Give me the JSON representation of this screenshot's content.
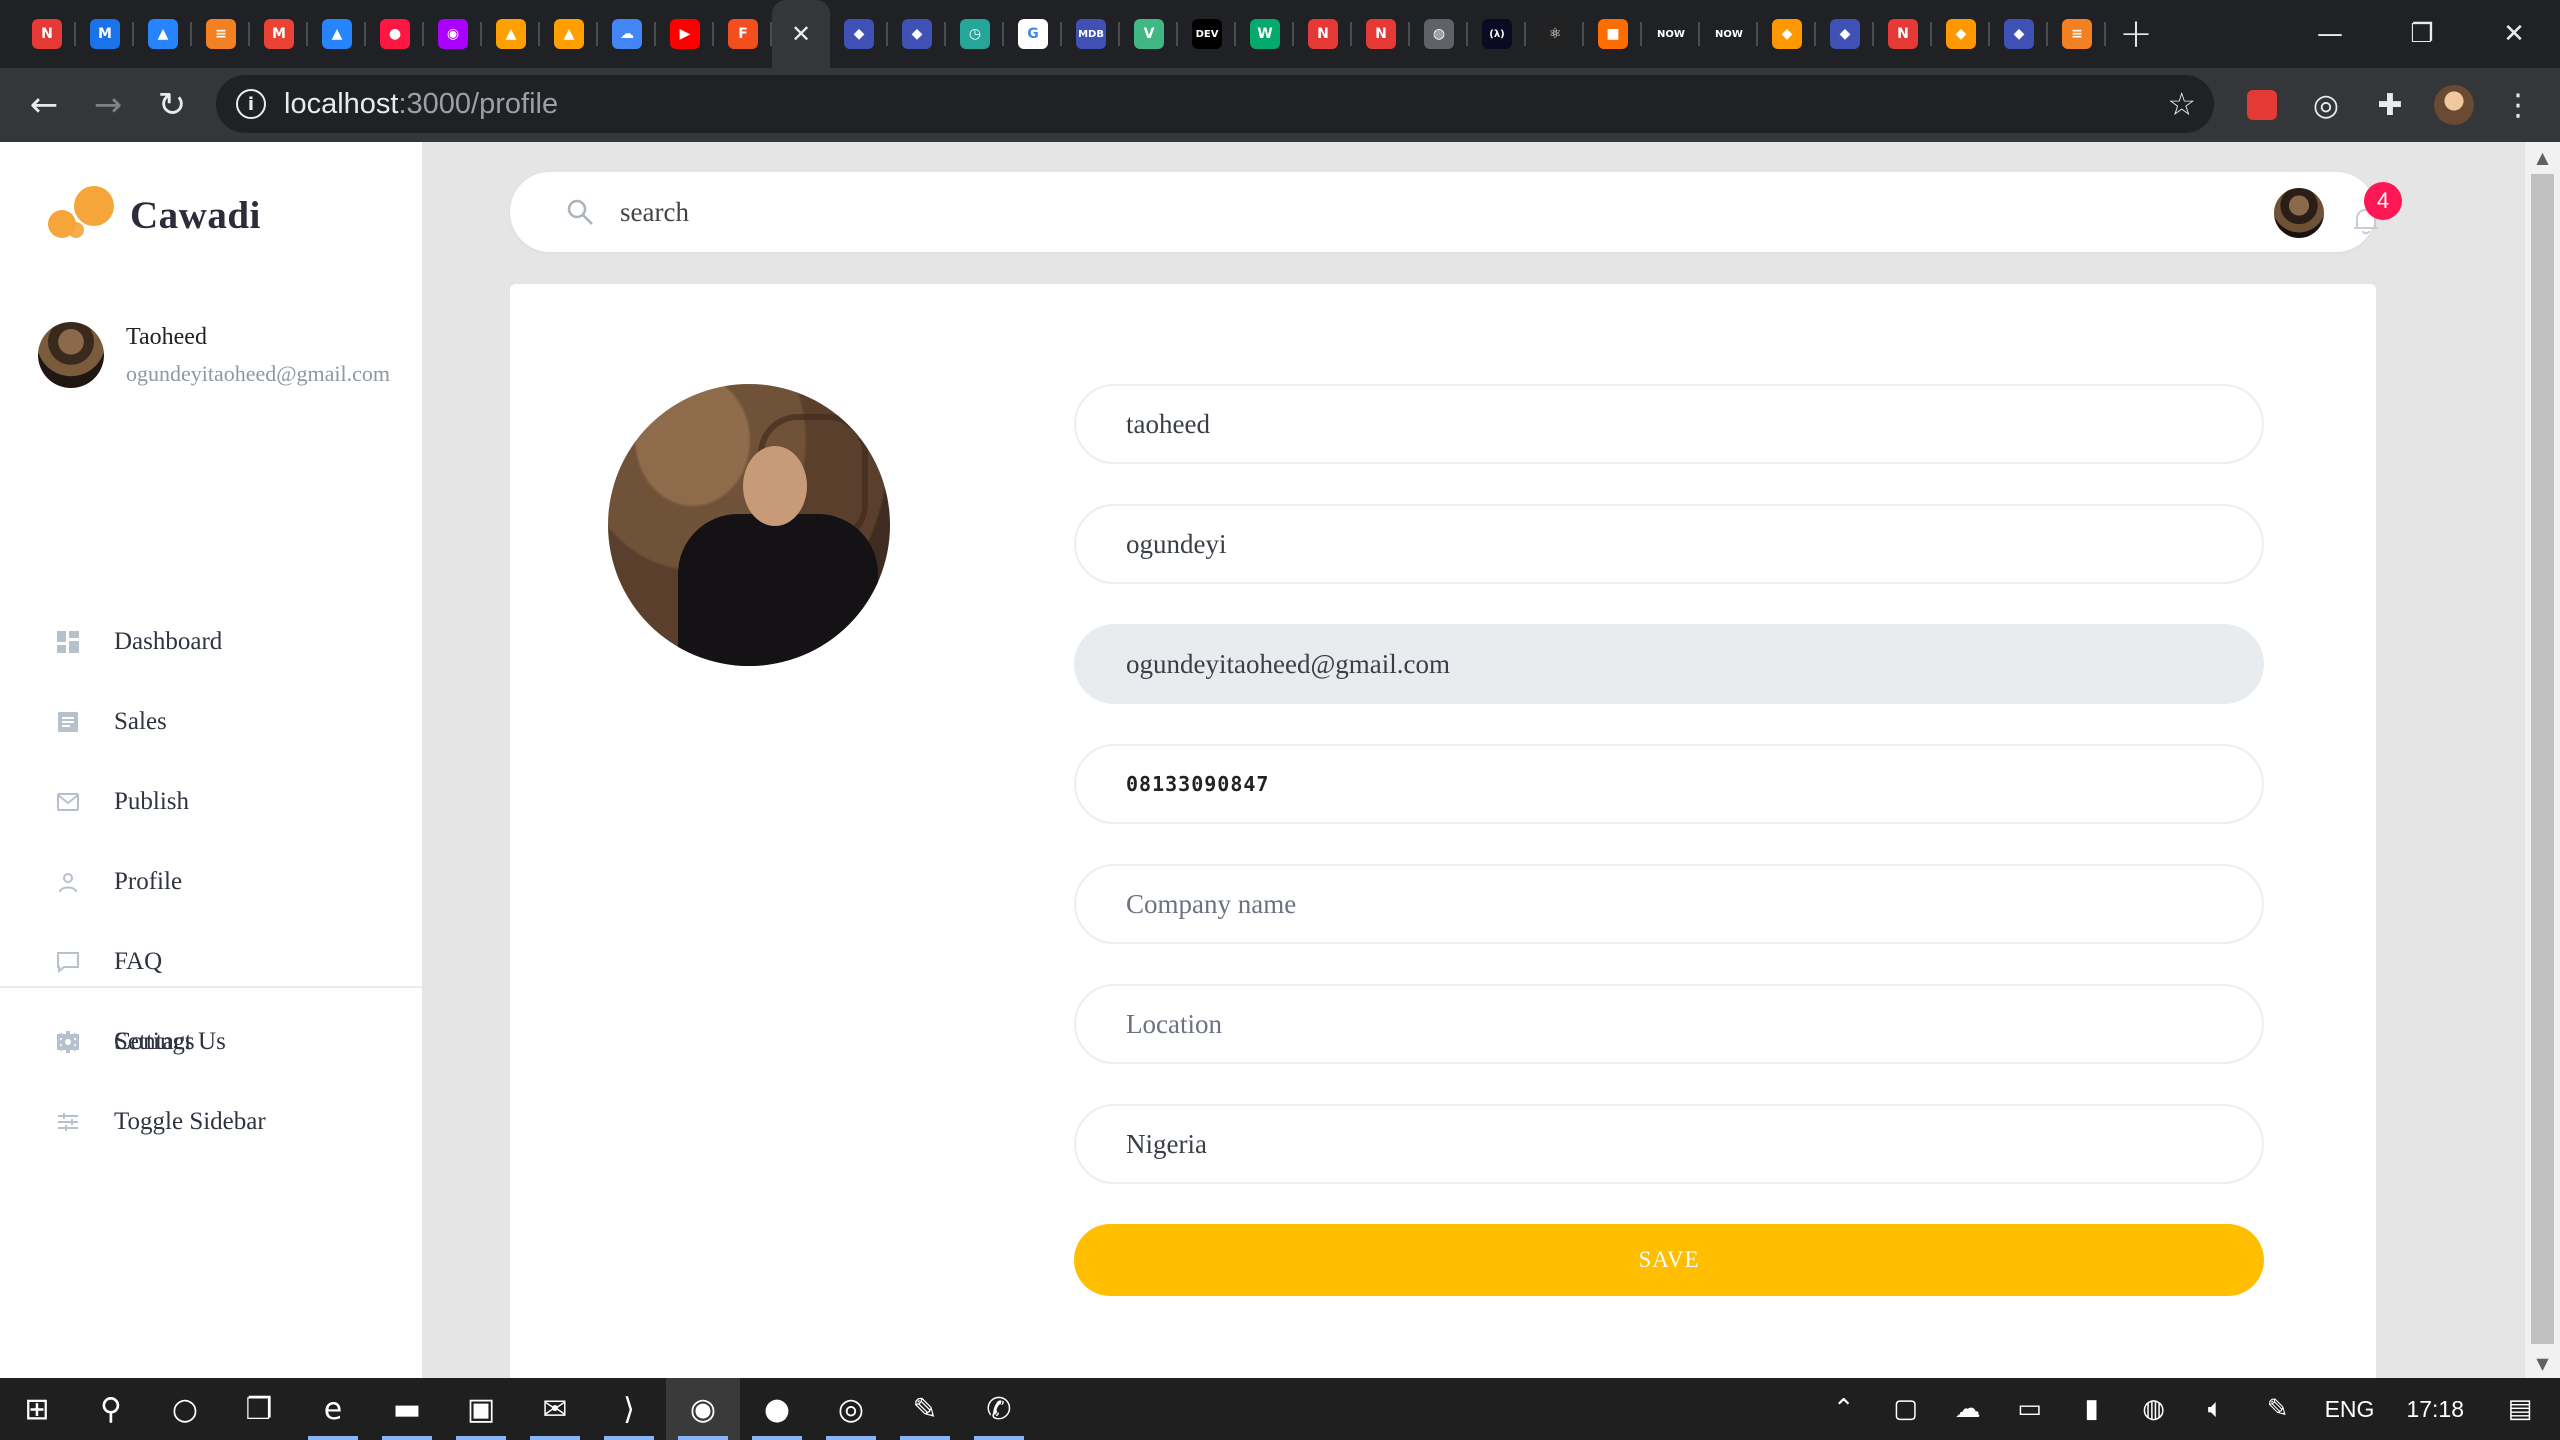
{
  "browser": {
    "tabs": [
      {
        "icon": "notion-red-icon",
        "glyph": "N",
        "bg": "#e53935"
      },
      {
        "icon": "mdn-icon",
        "glyph": "M",
        "bg": "#1a73e8"
      },
      {
        "icon": "atlassian-icon",
        "glyph": "▲",
        "bg": "#2684ff"
      },
      {
        "icon": "stackoverflow-icon",
        "glyph": "≡",
        "bg": "#f48024"
      },
      {
        "icon": "gmail-icon",
        "glyph": "M",
        "bg": "#ea4335"
      },
      {
        "icon": "atlassian-icon",
        "glyph": "▲",
        "bg": "#2684ff"
      },
      {
        "icon": "red-dots-icon",
        "glyph": "●",
        "bg": "#ff1744"
      },
      {
        "icon": "purple-app-icon",
        "glyph": "◉",
        "bg": "#aa00ff"
      },
      {
        "icon": "firebase-icon",
        "glyph": "▲",
        "bg": "#ffa000"
      },
      {
        "icon": "firebase-icon",
        "glyph": "▲",
        "bg": "#ffa000"
      },
      {
        "icon": "google-cloud-icon",
        "glyph": "☁",
        "bg": "#4285f4"
      },
      {
        "icon": "youtube-icon",
        "glyph": "▶",
        "bg": "#ff0000"
      },
      {
        "icon": "figma-icon",
        "glyph": "F",
        "bg": "#f24e1e"
      },
      {
        "icon": "close-icon",
        "glyph": "✕",
        "bg": "transparent"
      },
      {
        "icon": "jira-icon",
        "glyph": "◆",
        "bg": "#3f51b5"
      },
      {
        "icon": "jira-icon",
        "glyph": "◆",
        "bg": "#3f51b5"
      },
      {
        "icon": "clock-icon",
        "glyph": "◷",
        "bg": "#26a69a"
      },
      {
        "icon": "google-icon",
        "glyph": "G",
        "bg": "#ffffff"
      },
      {
        "icon": "mdb-icon",
        "glyph": "MDB",
        "bg": "#3f51b5"
      },
      {
        "icon": "vue-icon",
        "glyph": "V",
        "bg": "#41b883"
      },
      {
        "icon": "dev-icon",
        "glyph": "DEV",
        "bg": "#000000"
      },
      {
        "icon": "w3schools-icon",
        "glyph": "W",
        "bg": "#04aa6d"
      },
      {
        "icon": "notion-red-icon",
        "glyph": "N",
        "bg": "#e53935"
      },
      {
        "icon": "notion-red-icon",
        "glyph": "N",
        "bg": "#e53935"
      },
      {
        "icon": "globe-icon",
        "glyph": "◍",
        "bg": "#5f6368"
      },
      {
        "icon": "freecodecamp-icon",
        "glyph": "(λ)",
        "bg": "#0a0a23"
      },
      {
        "icon": "react-icon",
        "glyph": "⚛",
        "bg": "#222222"
      },
      {
        "icon": "cube-icon",
        "glyph": "■",
        "bg": "#ff6d00"
      },
      {
        "icon": "now-icon",
        "glyph": "NOW",
        "bg": "#202124"
      },
      {
        "icon": "now-icon",
        "glyph": "NOW",
        "bg": "#202124"
      },
      {
        "icon": "orange-diamond-icon",
        "glyph": "◆",
        "bg": "#ff9800"
      },
      {
        "icon": "jira-icon",
        "glyph": "◆",
        "bg": "#3f51b5"
      },
      {
        "icon": "notion-red-icon",
        "glyph": "N",
        "bg": "#e53935"
      },
      {
        "icon": "orange-diamond-icon",
        "glyph": "◆",
        "bg": "#ff9800"
      },
      {
        "icon": "jira-icon",
        "glyph": "◆",
        "bg": "#3f51b5"
      },
      {
        "icon": "stackoverflow-icon",
        "glyph": "≡",
        "bg": "#f48024"
      }
    ],
    "active_tab_index": 13,
    "url_host": "localhost",
    "url_path": ":3000/profile"
  },
  "app": {
    "brand": "Cawadi",
    "brand_color": "#f5a53a",
    "user": {
      "name": "Taoheed",
      "email": "ogundeyitaoheed@gmail.com"
    },
    "nav": [
      {
        "label": "Dashboard",
        "icon": "dashboard-icon"
      },
      {
        "label": "Sales",
        "icon": "document-icon"
      },
      {
        "label": "Publish",
        "icon": "mail-icon"
      },
      {
        "label": "Profile",
        "icon": "user-icon"
      },
      {
        "label": "FAQ",
        "icon": "chat-icon"
      },
      {
        "label": "Contact Us",
        "icon": "contact-card-icon"
      }
    ],
    "nav_secondary": [
      {
        "label": "Settings",
        "icon": "gear-icon"
      },
      {
        "label": "Toggle Sidebar",
        "icon": "sliders-icon"
      }
    ],
    "search": {
      "placeholder": "search"
    },
    "notifications": {
      "count": "4",
      "badge_color": "#ff1654"
    },
    "form": {
      "first_name": "taoheed",
      "last_name": "ogundeyi",
      "email": "ogundeyitaoheed@gmail.com",
      "phone": "08133090847",
      "company_placeholder": "Company name",
      "location_placeholder": "Location",
      "country": "Nigeria",
      "save_label": "SAVE",
      "save_color": "#ffbf00"
    }
  },
  "taskbar": {
    "apps": [
      {
        "icon": "windows-start-icon",
        "glyph": "⊞"
      },
      {
        "icon": "search-icon",
        "glyph": "⚲"
      },
      {
        "icon": "cortana-icon",
        "glyph": "○"
      },
      {
        "icon": "task-view-icon",
        "glyph": "❐"
      },
      {
        "icon": "edge-icon",
        "glyph": "e"
      },
      {
        "icon": "file-explorer-icon",
        "glyph": "▬"
      },
      {
        "icon": "store-icon",
        "glyph": "▣"
      },
      {
        "icon": "mail-icon",
        "glyph": "✉"
      },
      {
        "icon": "vscode-icon",
        "glyph": "⟩"
      },
      {
        "icon": "chrome-icon",
        "glyph": "◉"
      },
      {
        "icon": "postman-icon",
        "glyph": "●"
      },
      {
        "icon": "obs-icon",
        "glyph": "◎"
      },
      {
        "icon": "notepad-icon",
        "glyph": "✎"
      },
      {
        "icon": "whatsapp-icon",
        "glyph": "✆"
      }
    ],
    "language": "ENG",
    "time": "17:18"
  }
}
